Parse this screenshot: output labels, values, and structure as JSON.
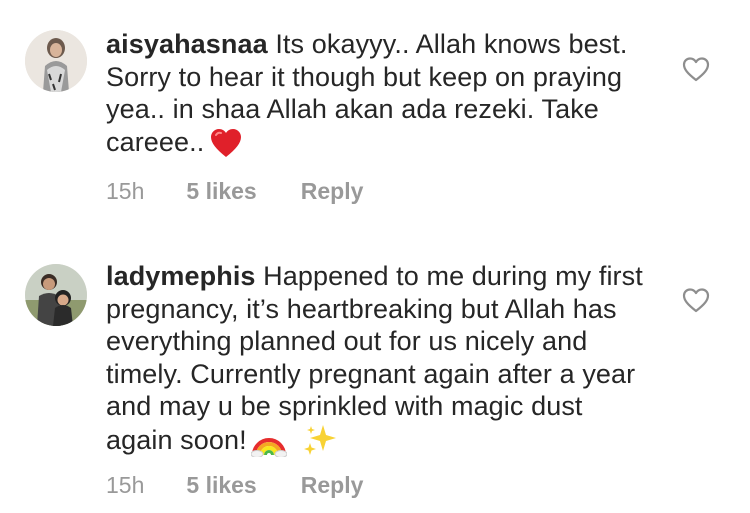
{
  "comments": [
    {
      "username": "aisyahasnaa",
      "text": "Its okayyy.. Allah knows best. Sorry to hear it though but keep on praying yea.. in shaa Allah akan ada rezeki. Take careee..",
      "emoji": "heart-emoji",
      "time": "15h",
      "likes": "5 likes",
      "reply": "Reply"
    },
    {
      "username": "ladymephis",
      "text": "Happened to me during my first pregnancy, it’s heartbreaking but Allah has everything planned out for us nicely and timely. Currently pregnant again after a year and may u be sprinkled with magic dust again soon!",
      "emoji_1": "rainbow-emoji",
      "emoji_2": "sparkles-emoji",
      "time": "15h",
      "likes": "5 likes",
      "reply": "Reply"
    }
  ],
  "colors": {
    "text": "#262626",
    "meta": "#999999",
    "heart": "#e0202a"
  }
}
